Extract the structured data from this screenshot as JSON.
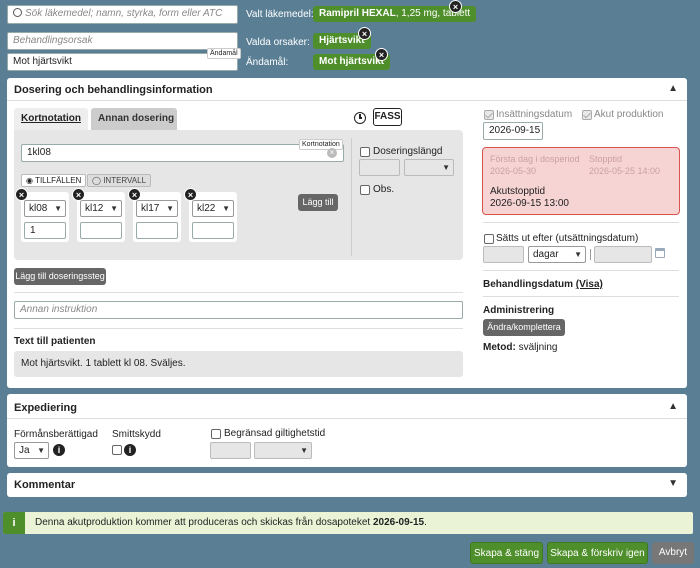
{
  "top": {
    "search_placeholder": "Sök läkemedel; namn, styrka, form eller ATC",
    "reason_placeholder": "Behandlingsorsak",
    "purpose_value": "Mot hjärtsvikt",
    "purpose_tiny_label": "Ändamål",
    "selected_drug_label": "Valt läkemedel:",
    "selected_drug_name": "Ramipril HEXAL",
    "selected_drug_detail": ", 1,25 mg, tablett",
    "selected_reasons_label": "Valda orsaker:",
    "selected_reason": "Hjärtsvikt",
    "purpose_label": "Ändamål:",
    "selected_purpose": "Mot hjärtsvikt",
    "remove_glyph": "×"
  },
  "dosing": {
    "title": "Dosering och behandlingsinformation",
    "collapse_glyph": "▲",
    "tabs": [
      "Kortnotation",
      "Annan dosering"
    ],
    "fass_label": "FASS",
    "short_notation_value": "1kl08",
    "short_notation_tiny_label": "Kortnotation",
    "mode_options": [
      "TILLFÄLLEN",
      "INTERVALL"
    ],
    "occasions": [
      {
        "time": "kl08",
        "amount": "1"
      },
      {
        "time": "kl12",
        "amount": ""
      },
      {
        "time": "kl17",
        "amount": ""
      },
      {
        "time": "kl22",
        "amount": ""
      }
    ],
    "add_button": "Lägg till",
    "duration_label": "Doseringslängd",
    "obs_label": "Obs.",
    "add_step_button": "Lägg till doseringssteg",
    "other_instruction_placeholder": "Annan instruktion",
    "patient_text_label": "Text till patienten",
    "patient_text": "Mot hjärtsvikt. 1 tablett kl 08. Sväljes.",
    "start_date_label": "Insättningsdatum",
    "start_date_value": "2026-09-15",
    "acute_label": "Akut produktion",
    "first_day_label": "Första dag i dosperiod",
    "first_day_value": "2026-05-30",
    "stop_time_label": "Stopptid",
    "stop_time_value": "2026-05-25 14:00",
    "acute_stop_label": "Akutstopptid",
    "acute_stop_value": "2026-09-15 13:00",
    "discontinue_label": "Sätts ut efter (utsättningsdatum)",
    "unit_value": "dagar",
    "treatment_date_label": "Behandlingsdatum",
    "treatment_date_link": "(Visa)",
    "admin_label": "Administrering",
    "admin_button": "Ändra/komplettera",
    "method_label": "Metod:",
    "method_value": "sväljning"
  },
  "dispensing": {
    "title": "Expediering",
    "collapse_glyph": "▲",
    "benefit_label": "Förmånsberättigad",
    "benefit_value": "Ja",
    "infection_label": "Smittskydd",
    "limited_label": "Begränsad giltighetstid"
  },
  "comment": {
    "title": "Kommentar",
    "expand_glyph": "▼"
  },
  "notice": {
    "text": "Denna akutproduktion kommer att produceras och skickas från dosapoteket ",
    "date": "2026-09-15",
    "end": "."
  },
  "footer": {
    "create_close": "Skapa & stäng",
    "create_prescribe": "Skapa & förskriv igen",
    "cancel": "Avbryt"
  },
  "colors": {
    "background": "#5a7f95",
    "accent_green": "#4f8f2b",
    "alert_red_bg": "#f7d4d4",
    "alert_red_border": "#d9534f",
    "notice_bg": "#eaf3d6"
  },
  "icons": [
    "search-icon",
    "close-icon",
    "clock-icon",
    "info-icon",
    "calendar-icon",
    "chevron-down-icon"
  ]
}
